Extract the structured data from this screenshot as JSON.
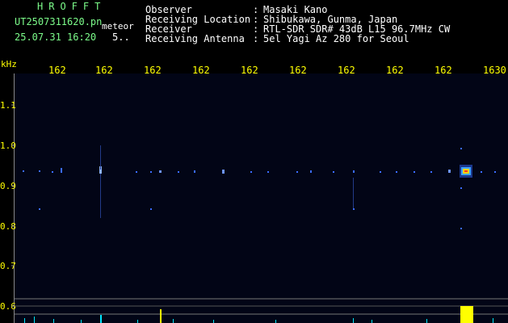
{
  "header": {
    "logo": "HROFFT",
    "filename": "UT2507311620.pn",
    "mode": "meteor",
    "datetime": "25.07.31 16:20",
    "number": "5..",
    "rows": [
      {
        "label": "Observer",
        "value": "Masaki Kano"
      },
      {
        "label": "Receiving Location",
        "value": "Shibukawa, Gunma, Japan"
      },
      {
        "label": "Receiver",
        "value": "RTL-SDR SDR# 43dB L15 96.7MHz CW"
      },
      {
        "label": "Receiving Antenna",
        "value": "5el Yagi Az 280 for Seoul"
      }
    ]
  },
  "axis": {
    "unit": "kHz",
    "y_ticks": [
      "1.1",
      "1.0",
      "0.9",
      "0.8",
      "0.7",
      "0.6"
    ],
    "x_ticks": [
      "162",
      "162",
      "162",
      "162",
      "162",
      "162",
      "162",
      "162",
      "162",
      "1630"
    ]
  },
  "colors": {
    "text_green": "#7CFC8A",
    "text_white": "#ffffff",
    "tick_yellow": "#ffff00",
    "background": "#000000",
    "trace_cyan": "#00e5ff",
    "burst_yellow": "#ffff00"
  }
}
